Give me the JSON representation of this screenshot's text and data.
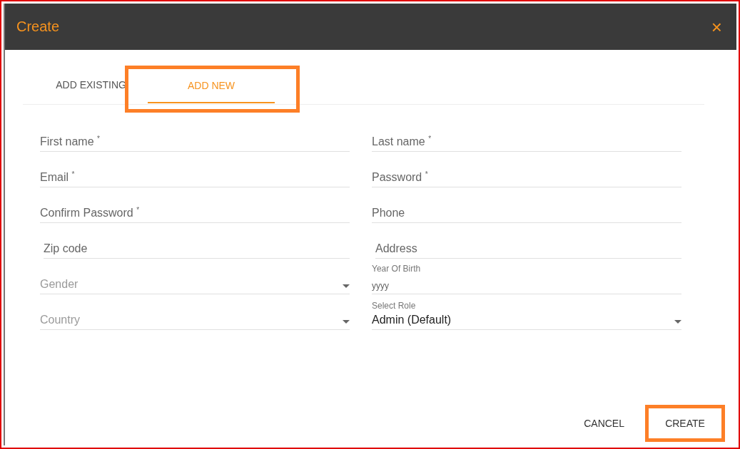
{
  "dialog": {
    "title": "Create",
    "close": "×"
  },
  "tabs": [
    {
      "label": "ADD EXISTING",
      "selected": false,
      "highlighted": false
    },
    {
      "label": "ADD NEW",
      "selected": true,
      "highlighted": true
    }
  ],
  "form_rows": [
    [
      {
        "kind": "text",
        "placeholder": "First name $^{*}$"
      },
      {
        "kind": "text",
        "placeholder": "Last name $^{*}$"
      }
    ],
    [
      {
        "kind": "text",
        "placeholder": "Email $^{*}$"
      },
      {
        "kind": "text",
        "placeholder": "Password $^{*}$"
      }
    ],
    [
      {
        "kind": "text",
        "placeholder": "Confirm Password $^{*}$"
      },
      {
        "kind": "text",
        "placeholder": "Phone"
      }
    ],
    [
      {
        "kind": "text",
        "placeholder": "Zip code"
      },
      {
        "kind": "text",
        "placeholder": "Address"
      }
    ],
    [
      {
        "kind": "select",
        "placeholder": "Gender"
      },
      {
        "kind": "date",
        "label": "Year Of Birth",
        "placeholder": "yyyy"
      }
    ],
    [
      {
        "kind": "select",
        "placeholder": "Country"
      },
      {
        "kind": "select",
        "label": "Select Role",
        "value": "Admin (Default)"
      }
    ]
  ],
  "buttons": [
    {
      "label": "CANCEL",
      "highlighted": false
    },
    {
      "label": "CREATE",
      "highlighted": true
    }
  ]
}
